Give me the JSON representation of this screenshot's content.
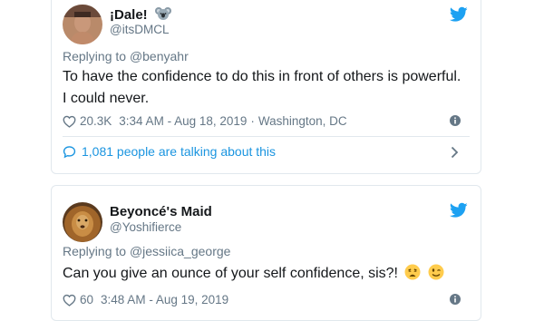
{
  "tweets": [
    {
      "display_name": "¡Dale!",
      "name_emoji": "koala-emoji",
      "handle": "@itsDMCL",
      "replying_label": "Replying to",
      "replying_to": "@benyahr",
      "text": "To have the confidence to do this in front of others is powerful. I could never.",
      "likes": "20.3K",
      "time": "3:34 AM - Aug 18, 2019",
      "separator": "·",
      "location": "Washington, DC",
      "talking": "1,081 people are talking about this"
    },
    {
      "display_name": "Beyoncé's Maid",
      "handle": "@Yoshifierce",
      "replying_label": "Replying to",
      "replying_to": "@jessiica_george",
      "text": "Can you give an ounce of your self confidence, sis?!",
      "text_emojis": [
        "weary-face-emoji",
        "winking-face-emoji"
      ],
      "likes": "60",
      "time": "3:48 AM - Aug 19, 2019"
    }
  ],
  "colors": {
    "twitter_blue": "#1da1f2",
    "link_blue": "#1b95e0",
    "secondary_text": "#657786",
    "border": "#e1e8ed"
  }
}
